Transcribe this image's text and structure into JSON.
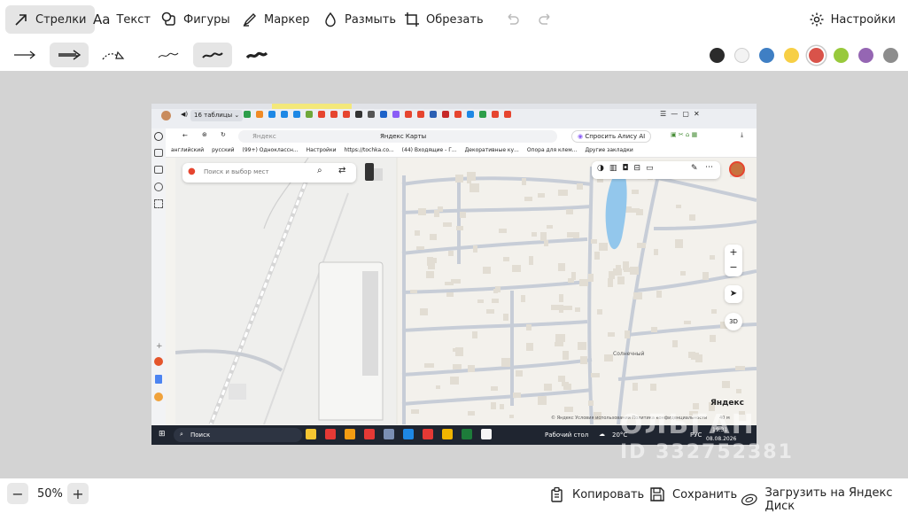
{
  "toolbar": {
    "tools": [
      {
        "label": "Стрелки",
        "icon": "arrow-tool-icon",
        "active": true
      },
      {
        "label": "Текст",
        "icon": "text-tool-icon",
        "active": false
      },
      {
        "label": "Фигуры",
        "icon": "shapes-tool-icon",
        "active": false
      },
      {
        "label": "Маркер",
        "icon": "marker-tool-icon",
        "active": false
      },
      {
        "label": "Размыть",
        "icon": "blur-tool-icon",
        "active": false
      },
      {
        "label": "Обрезать",
        "icon": "crop-tool-icon",
        "active": false
      }
    ],
    "settings_label": "Настройки"
  },
  "options": {
    "arrow_styles": [
      "thin-arrow",
      "thick-arrow",
      "dashed-arrow"
    ],
    "selected_arrow_style": "thick-arrow",
    "stroke_widths": [
      "thin",
      "medium",
      "thick"
    ],
    "selected_stroke_width": "medium",
    "colors": [
      "#2b2b2b",
      "#f3f3f3",
      "#3f7fc4",
      "#f7cf45",
      "#d9534a",
      "#98c93c",
      "#9566b3",
      "#8d8d8d"
    ],
    "selected_color": "#d9534a"
  },
  "bottom": {
    "zoom": "50%",
    "zoom_out": "−",
    "zoom_in": "+",
    "copy_label": "Копировать",
    "save_label": "Сохранить",
    "upload_label": "Загрузить на Яндекс Диск"
  },
  "watermark": {
    "line1": "ОЛЬГАН",
    "line2": "ID 332752381"
  },
  "screenshot": {
    "tab_text": "16 таблицы",
    "address_placeholder": "Яндекс",
    "page_title": "Яндекс Карты",
    "alice_button": "Спросить Алису AI",
    "bookmarks": [
      "английский",
      "русский",
      "(99+) Одноклассн...",
      "Настройки",
      "https://tochka.co...",
      "(44) Входящие - Г...",
      "Декоративные ку...",
      "Опора для клем...",
      "Другие закладки"
    ],
    "map_search_placeholder": "Поиск и выбор мест",
    "map_brand": "Яндекс",
    "map_3d": "3D",
    "map_scale": "40 м",
    "street_label": "Солнечный",
    "copyright": "© Яндекс  Условия использования  Политика конфиденциальности",
    "taskbar_search": "Поиск",
    "taskbar_desktop": "Рабочий стол",
    "weather": "20°C",
    "lang": "РУС",
    "time": "19:31",
    "date": "08.08.2026"
  }
}
